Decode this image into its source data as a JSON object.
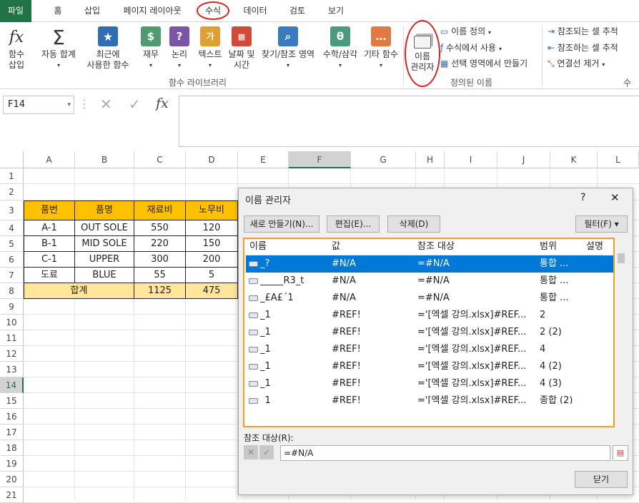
{
  "tabs": [
    "파일",
    "홈",
    "삽입",
    "페이지 레이아웃",
    "수식",
    "데이터",
    "검토",
    "보기"
  ],
  "ribbon": {
    "fx_insert": [
      "함수",
      "삽입"
    ],
    "autosum": [
      "자동 합계"
    ],
    "recent": [
      "최근에",
      "사용한 함수"
    ],
    "finance": "재무",
    "logic": "논리",
    "text": "텍스트",
    "datetime": [
      "날짜 및",
      "시간"
    ],
    "lookup": "찾기/참조 영역",
    "math": "수학/삼각",
    "other": "기타 함수",
    "namemgr": [
      "이름",
      "관리자"
    ],
    "define_name": "이름 정의",
    "use_in_formula": "수식에서 사용",
    "create_from_sel": "선택 영역에서 만들기",
    "trace_precedents": "참조되는 셀 추적",
    "trace_dependents": "참조하는 셀 추적",
    "remove_arrows": "연결선 제거",
    "group_library": "함수 라이브러리",
    "group_names": "정의된 이름",
    "group_audit": "수식"
  },
  "formula": {
    "name_box": "F14",
    "fx": "fx",
    "value": ""
  },
  "columns": [
    "A",
    "B",
    "C",
    "D",
    "E",
    "F",
    "G",
    "H",
    "I",
    "J",
    "K",
    "L"
  ],
  "rows": [
    "1",
    "2",
    "3",
    "4",
    "5",
    "6",
    "7",
    "8",
    "9",
    "10",
    "11",
    "12",
    "13",
    "14",
    "15",
    "16",
    "17",
    "18",
    "19",
    "20",
    "21"
  ],
  "table": {
    "headers": [
      "품번",
      "품명",
      "재료비",
      "노무비"
    ],
    "rows": [
      [
        "A-1",
        "OUT SOLE",
        "550",
        "120"
      ],
      [
        "B-1",
        "MID SOLE",
        "220",
        "150"
      ],
      [
        "C-1",
        "UPPER",
        "300",
        "200"
      ],
      [
        "도료",
        "BLUE",
        "55",
        "5"
      ]
    ],
    "total_label": "합계",
    "total_values": [
      "1125",
      "475"
    ]
  },
  "dialog": {
    "title": "이름 관리자",
    "help": "?",
    "close": "✕",
    "btn_new": "새로 만들기(N)...",
    "btn_edit": "편집(E)...",
    "btn_delete": "삭제(D)",
    "btn_filter": "필터(F) ▾",
    "col_headers": [
      "이름",
      "값",
      "참조 대상",
      "범위",
      "설명"
    ],
    "rows": [
      [
        "_?",
        "#N/A",
        "=#N/A",
        "통합 ..."
      ],
      [
        "_____R3_t",
        "#N/A",
        "=#N/A",
        "통합 ..."
      ],
      [
        "_£A£´1",
        "#N/A",
        "=#N/A",
        "통합 ..."
      ],
      [
        "_1",
        "#REF!",
        "='[엑셀 강의.xlsx]#REF...",
        "2"
      ],
      [
        "_1",
        "#REF!",
        "='[엑셀 강의.xlsx]#REF...",
        "2 (2)"
      ],
      [
        "_1",
        "#REF!",
        "='[엑셀 강의.xlsx]#REF...",
        "4"
      ],
      [
        "_1",
        "#REF!",
        "='[엑셀 강의.xlsx]#REF...",
        "4 (2)"
      ],
      [
        "_1",
        "#REF!",
        "='[엑셀 강의.xlsx]#REF...",
        "4 (3)"
      ],
      [
        "_1",
        "#REF!",
        "='[엑셀 강의.xlsx]#REF...",
        "종합 (2)"
      ]
    ],
    "refers_label": "참조 대상(R):",
    "refers_value": "=#N/A",
    "btn_close": "닫기"
  },
  "colors": {
    "excel_green": "#217346",
    "highlight_orange": "#f0a020",
    "selection_blue": "#0078d7",
    "header_fill": "#ffc000",
    "total_fill": "#ffe699"
  }
}
